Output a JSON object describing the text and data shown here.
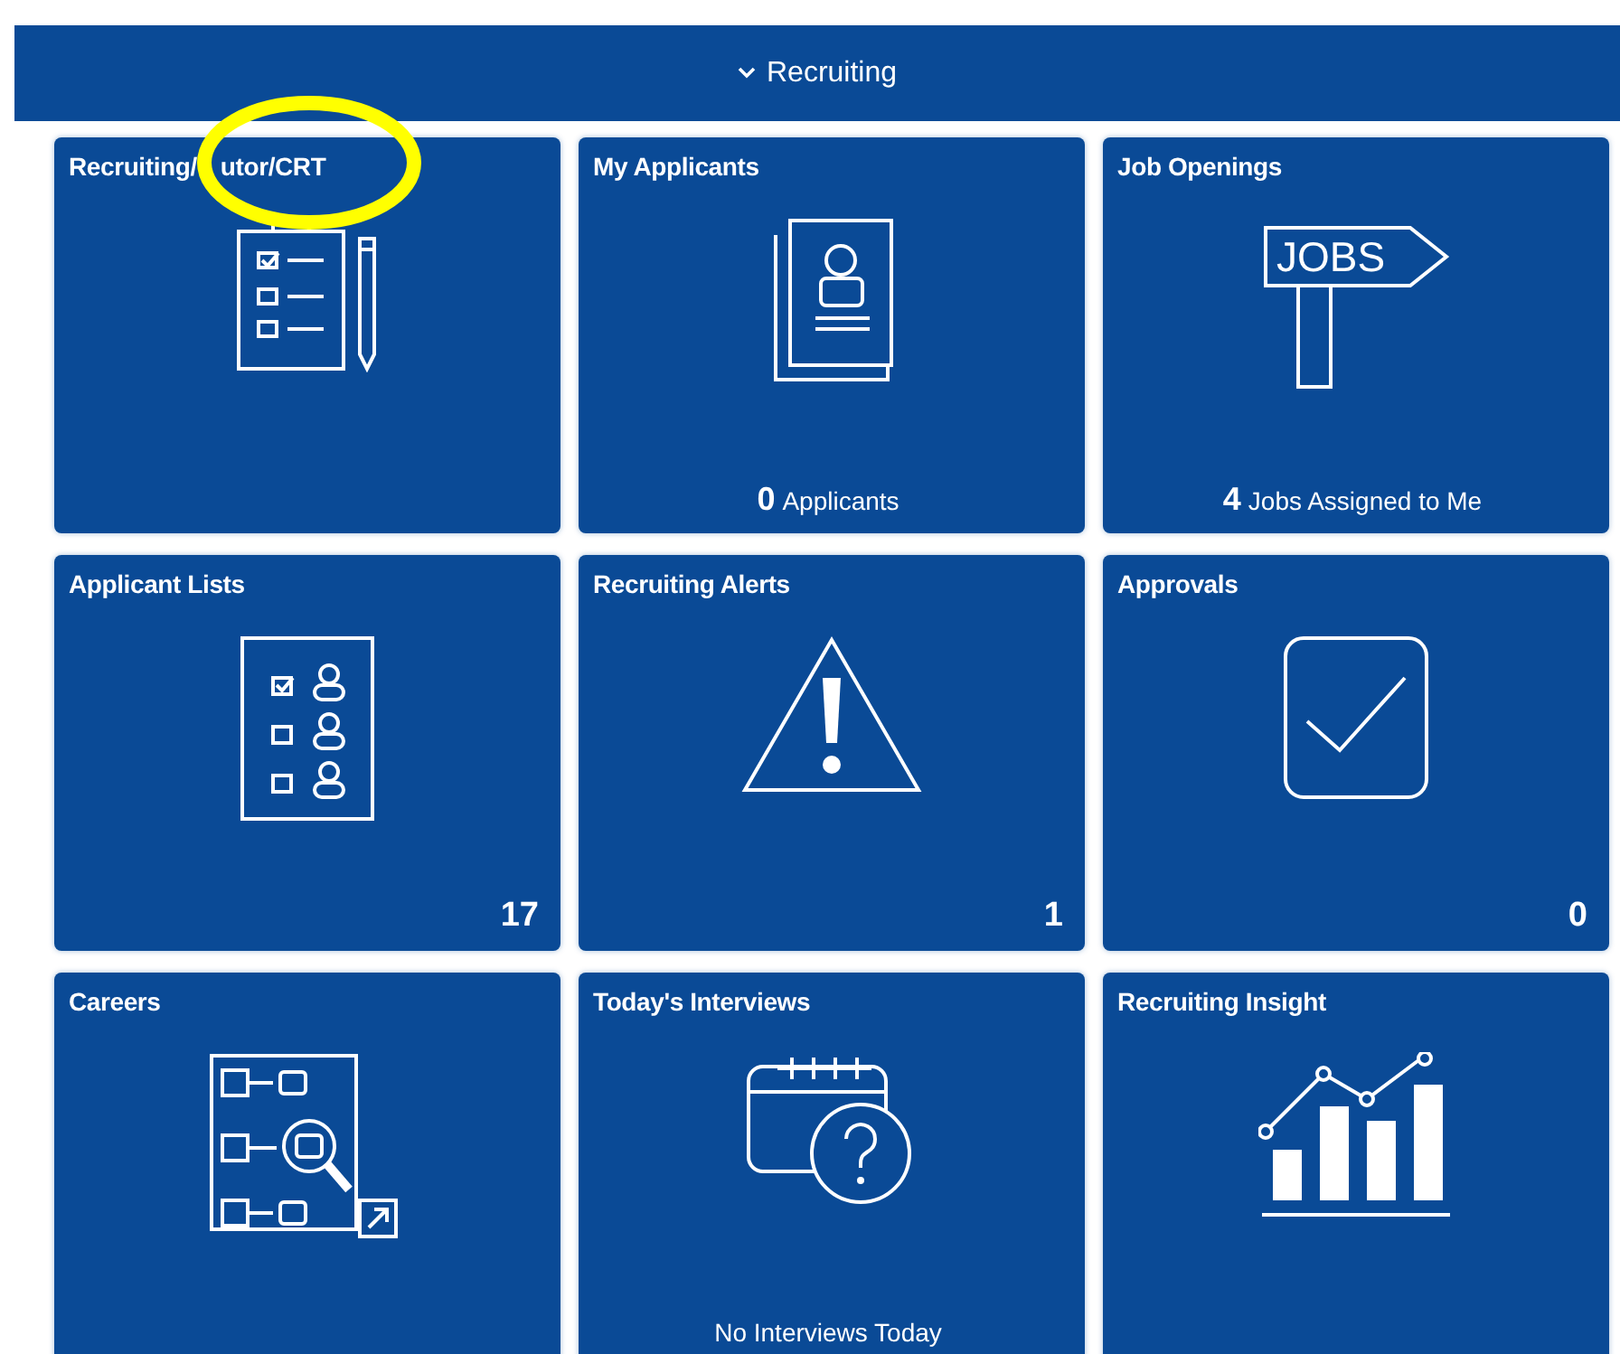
{
  "section": {
    "title": "Recruiting",
    "expanded": true
  },
  "tiles": [
    {
      "title": "Recruiting/",
      "title_continued": "utor/CRT",
      "highlighted": true
    },
    {
      "title": "My Applicants",
      "footer": {
        "kind": "count_label",
        "count": "0",
        "label": "Applicants"
      }
    },
    {
      "title": "Job Openings",
      "footer": {
        "kind": "count_label",
        "count": "4",
        "label": "Jobs Assigned to Me"
      },
      "sign_text": "JOBS"
    },
    {
      "title": "Applicant Lists",
      "footer": {
        "kind": "count",
        "count": "17"
      }
    },
    {
      "title": "Recruiting Alerts",
      "footer": {
        "kind": "count",
        "count": "1"
      }
    },
    {
      "title": "Approvals",
      "footer": {
        "kind": "count",
        "count": "0"
      }
    },
    {
      "title": "Careers"
    },
    {
      "title": "Today's Interviews",
      "footer": {
        "kind": "text",
        "label": "No Interviews Today"
      }
    },
    {
      "title": "Recruiting Insight"
    }
  ]
}
